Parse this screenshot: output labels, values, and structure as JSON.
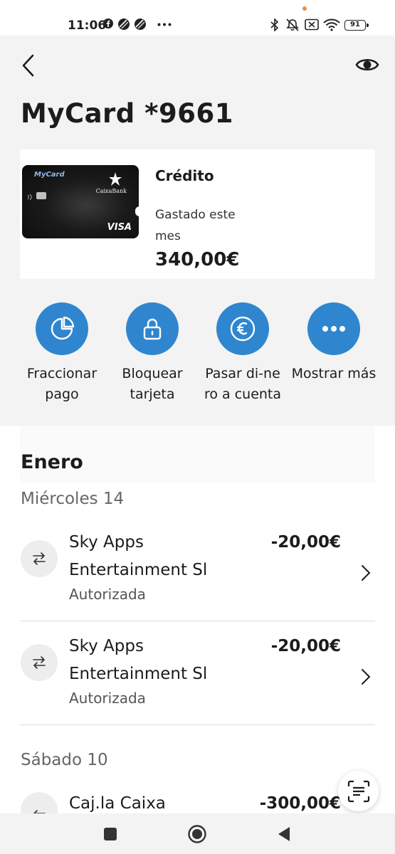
{
  "status_bar": {
    "time": "11:06",
    "battery": "91",
    "icons": [
      "facebook-icon",
      "app-icon",
      "app-icon",
      "more-dots-icon",
      "bluetooth-icon",
      "mute-icon",
      "sim-off-icon",
      "wifi-icon",
      "battery-icon"
    ]
  },
  "header": {
    "back_icon": "chevron-left-icon",
    "eye_icon": "eye-icon"
  },
  "page": {
    "title": "MyCard *9661"
  },
  "card": {
    "image_name": "MyCard",
    "image_bank": "CaixaBank",
    "image_network": "VISA",
    "type": "Crédito",
    "spent_label": "Gastado este mes",
    "spent_amount": "340,00€"
  },
  "actions": [
    {
      "label": "Fraccionar pago",
      "icon": "pie-chart-icon"
    },
    {
      "label": "Bloquear tarjeta",
      "icon": "lock-icon"
    },
    {
      "label": "Pasar di-nero a cuenta",
      "icon": "euro-icon"
    },
    {
      "label": "Mostrar más",
      "icon": "more-icon"
    }
  ],
  "transactions": {
    "month": "Enero",
    "groups": [
      {
        "day": "Miércoles 14",
        "items": [
          {
            "name": "Sky Apps Entertainment Sl",
            "status": "Autorizada",
            "amount": "-20,00€"
          },
          {
            "name": "Sky Apps Entertainment Sl",
            "status": "Autorizada",
            "amount": "-20,00€"
          }
        ]
      },
      {
        "day": "Sábado 10",
        "items": [
          {
            "name": "Caj.la Caixa",
            "amount": "-300,00€"
          }
        ]
      }
    ]
  },
  "colors": {
    "accent": "#2f86cf",
    "background": "#f3f3f3",
    "panel": "#ffffff",
    "status_dot": "#f08a3c"
  }
}
